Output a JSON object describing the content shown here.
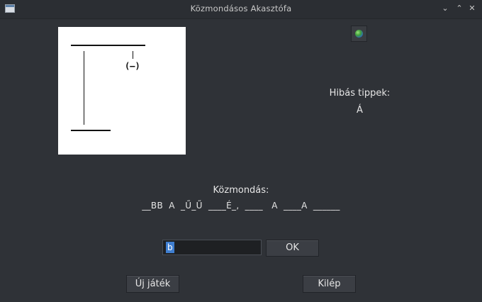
{
  "window": {
    "title": "Közmondásos Akasztófa",
    "controls": [
      "minimize",
      "maximize",
      "close"
    ]
  },
  "hangman": {
    "head_glyph": "(–)"
  },
  "language_button": {
    "icon": "globe-icon"
  },
  "wrong_guesses": {
    "label": "Hibás tippek:",
    "letters": "Á"
  },
  "proverb": {
    "label": "Közmondás:",
    "pattern": "__BB  A  _Ű_Ű  ____É_,  ____   A  ____A  ______"
  },
  "guess": {
    "value": "b",
    "ok_label": "OK"
  },
  "buttons": {
    "new_game": "Új játék",
    "quit": "Kilép"
  }
}
